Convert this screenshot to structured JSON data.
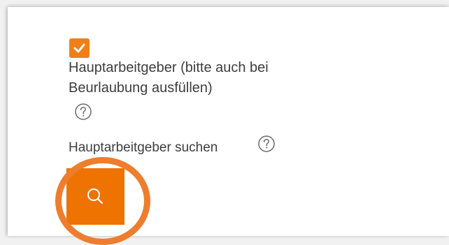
{
  "main_employer": {
    "checkbox_checked": true,
    "checkbox_label": "Hauptarbeitgeber (bitte auch bei Beurlaubung ausfüllen)"
  },
  "search": {
    "label": "Hauptarbeitgeber suchen"
  },
  "icons": {
    "checkmark": "check-icon",
    "help": "question-circle-icon",
    "search": "magnifier-icon"
  },
  "colors": {
    "accent": "#ee7300",
    "highlight_ring": "#ee7d2e",
    "text": "#3d3d3d"
  }
}
